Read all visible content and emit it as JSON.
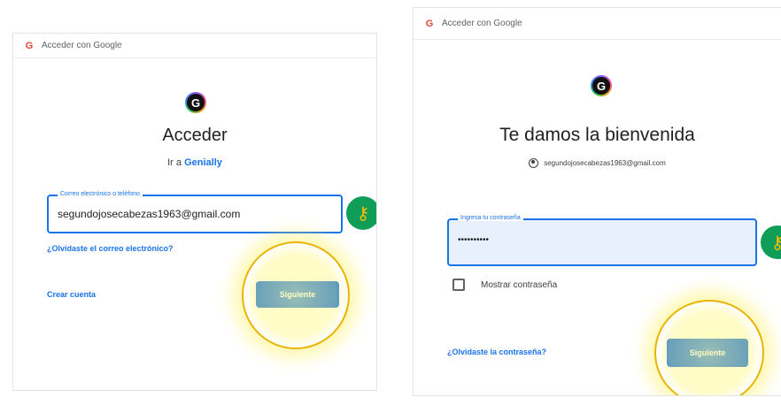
{
  "left": {
    "window_title": "Acceder con Google",
    "logo_letter": "G",
    "heading": "Acceder",
    "subtitle_prefix": "Ir a",
    "subtitle_link": "Genially",
    "email_field": {
      "label": "Correo electrónico o teléfono",
      "value": "segundojosecabezas1963@gmail.com"
    },
    "forgot_email": "¿Olvidaste el correo electrónico?",
    "create_account": "Crear cuenta",
    "next_button": "Siguiente"
  },
  "right": {
    "window_title": "Acceder con Google",
    "logo_letter": "G",
    "heading": "Te damos la bienvenida",
    "account_email": "segundojosecabezas1963@gmail.com",
    "password_field": {
      "label": "Ingresa tu contraseña",
      "value": "••••••••••"
    },
    "show_password_label": "Mostrar contraseña",
    "forgot_password": "¿Olvidaste la contraseña?",
    "next_button": "Siguiente"
  },
  "colors": {
    "accent": "#1a73e8",
    "highlight_ring": "#e8b400",
    "key_badge": "#0f9d58",
    "key_glyph": "#fbbc04"
  },
  "icons": [
    "google-g-icon",
    "genially-logo-icon",
    "key-icon",
    "account-circle-icon"
  ]
}
